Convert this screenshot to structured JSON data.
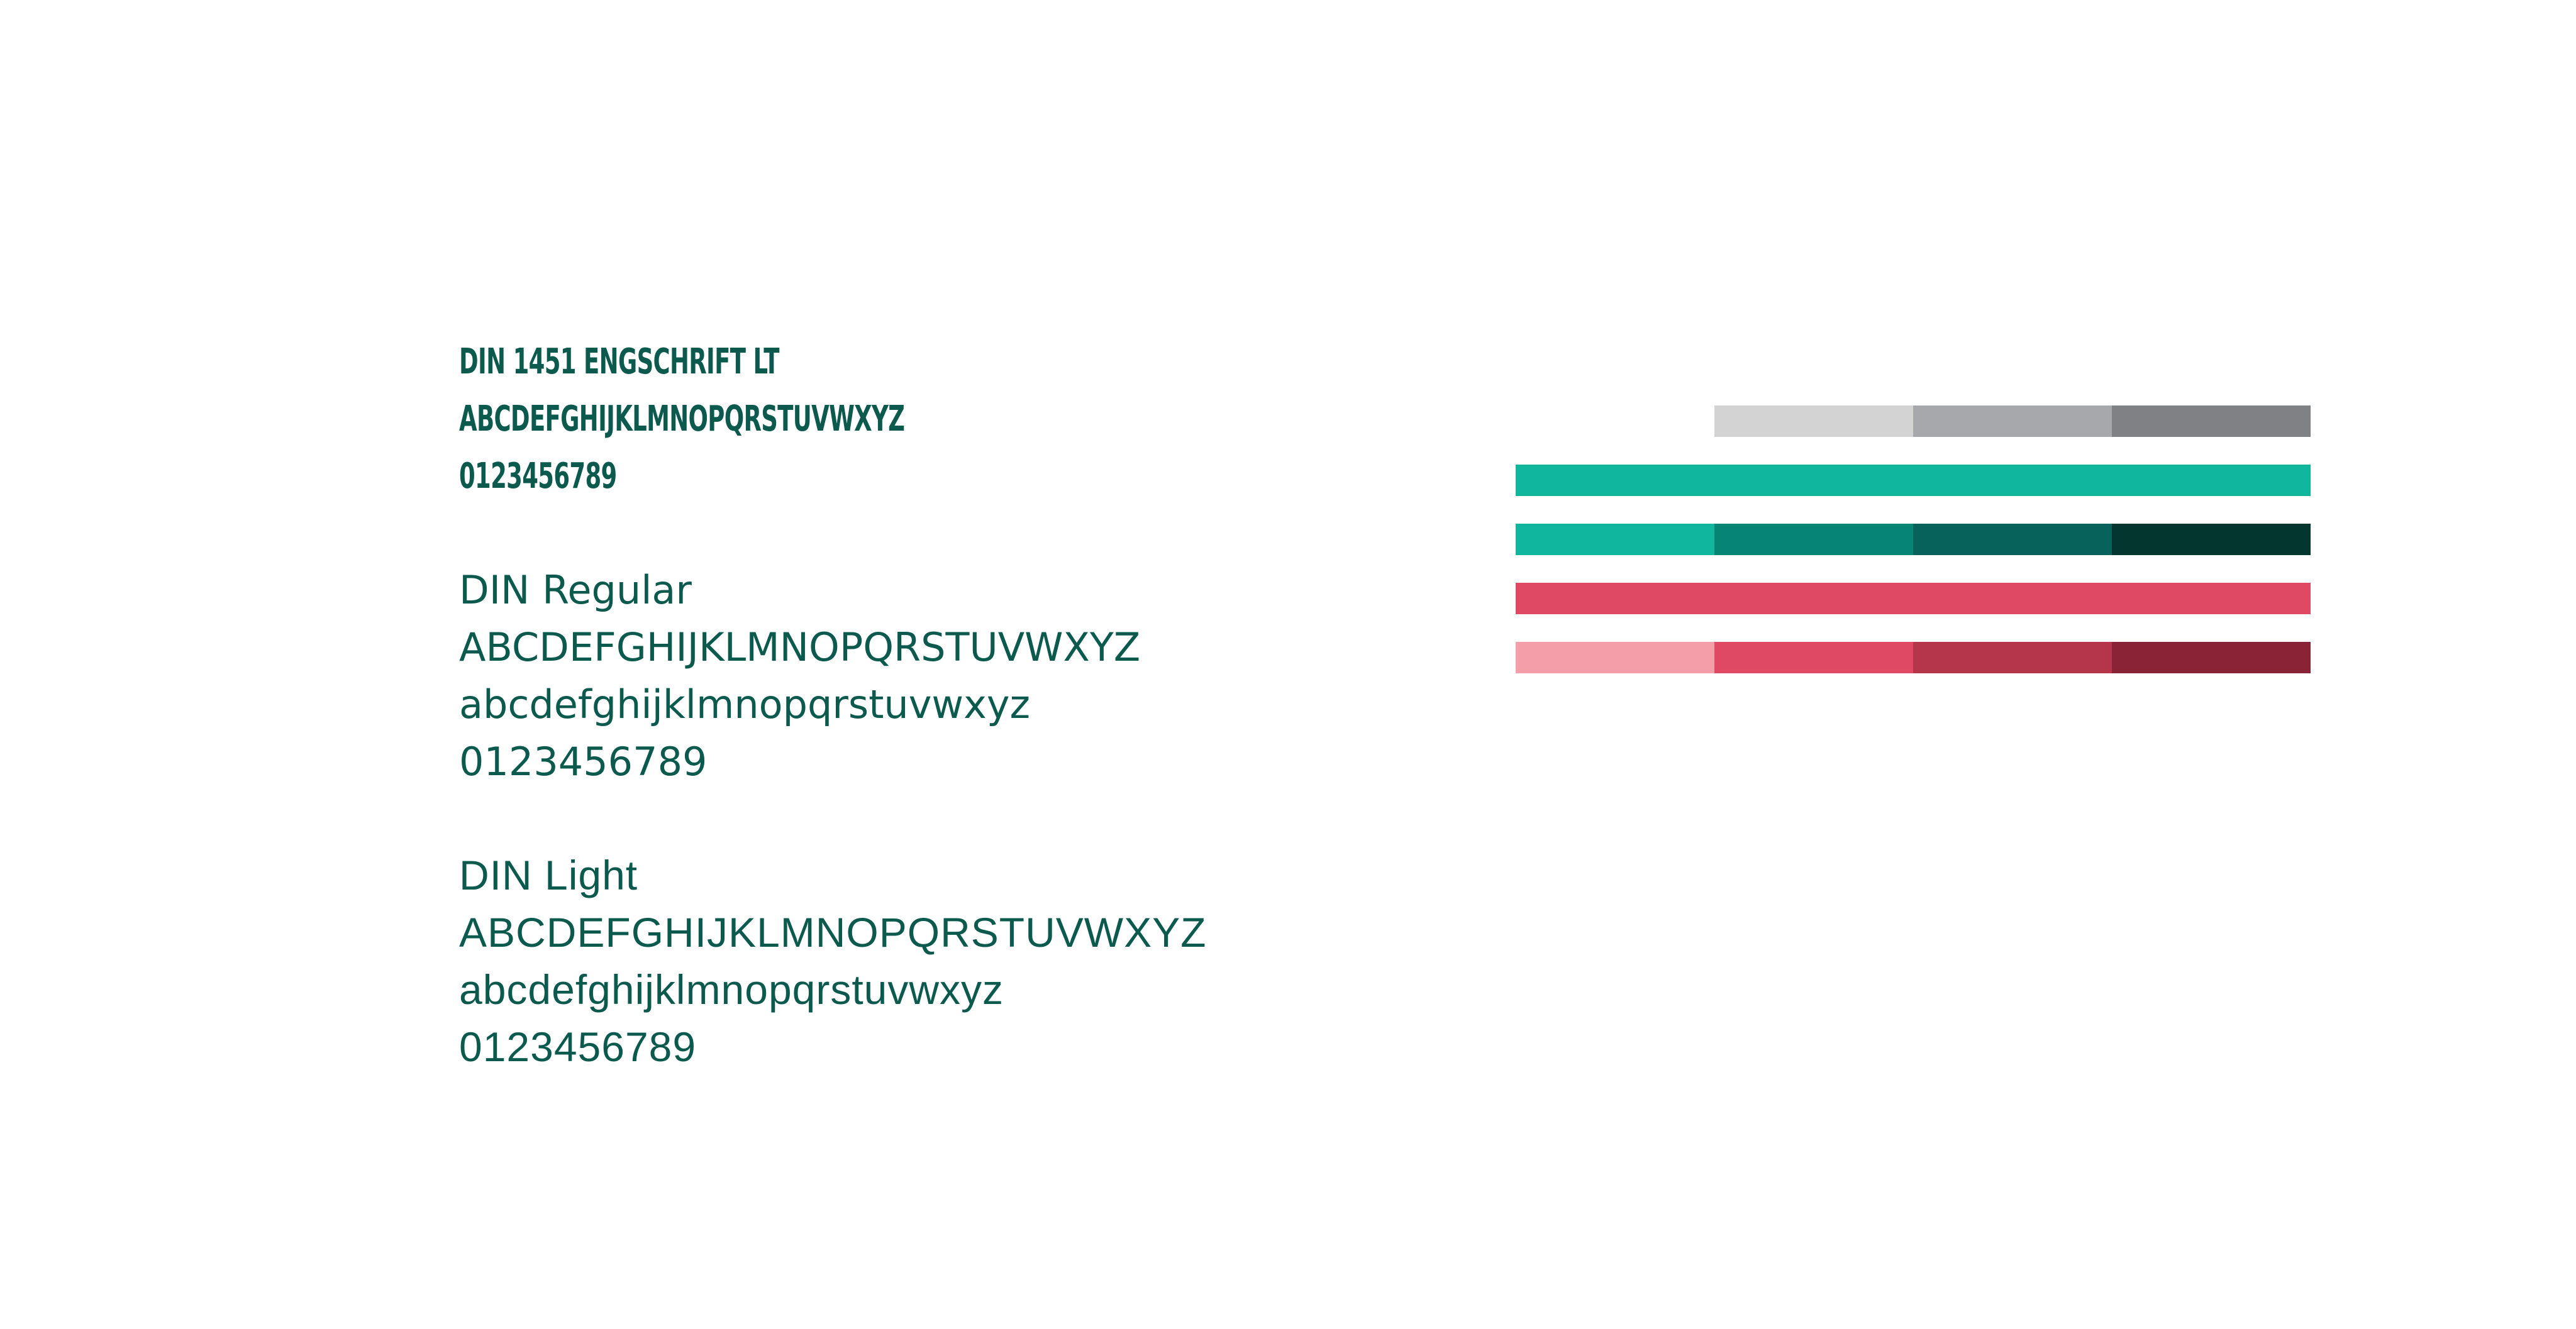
{
  "typography": {
    "condensed": {
      "name": "DIN 1451 ENGSCHRIFT LT",
      "uppercase": "ABCDEFGHIJKLMNOPQRSTUVWXYZ",
      "digits": "0123456789"
    },
    "regular": {
      "name": "DIN Regular",
      "uppercase": "ABCDEFGHIJKLMNOPQRSTUVWXYZ",
      "lowercase": "abcdefghijklmnopqrstuvwxyz",
      "digits": "0123456789"
    },
    "light": {
      "name": "DIN Light",
      "uppercase": "ABCDEFGHIJKLMNOPQRSTUVWXYZ",
      "lowercase": "abcdefghijklmnopqrstuvwxyz",
      "digits": "0123456789"
    },
    "text_color": "#0b5a4d"
  },
  "palette": {
    "grays": [
      "#d3d3d4",
      "#a7a8ab",
      "#808184"
    ],
    "teal_primary": "#10b79e",
    "teal_shades": [
      "#10b79e",
      "#078574",
      "#06625a",
      "#03362e"
    ],
    "red_primary": "#e04963",
    "red_shades": [
      "#f39ea9",
      "#e04963",
      "#b5364b",
      "#882435"
    ]
  }
}
